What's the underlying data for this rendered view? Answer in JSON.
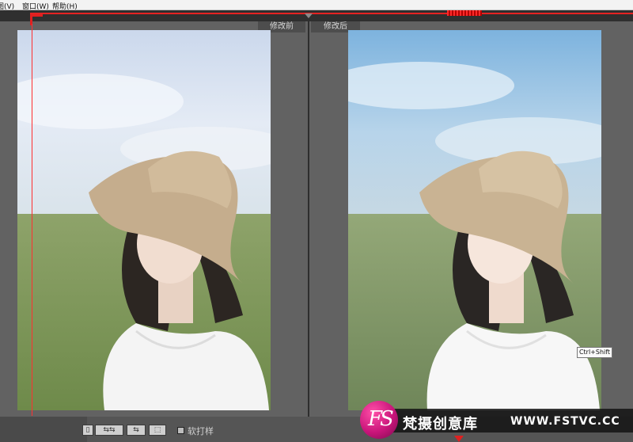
{
  "menu": {
    "items": [
      "图(V)",
      "窗口(W)",
      "帮助(H)"
    ]
  },
  "compare": {
    "before_label": "修改前",
    "after_label": "修改后"
  },
  "tooltip": {
    "text": "Ctrl+Shift"
  },
  "bottom": {
    "tool_icons": [
      "arrows-lr-icon",
      "arrows-lr-icon",
      "arrow-left-icon",
      "copy-settings-icon"
    ],
    "checkbox_label": "软打样"
  },
  "watermark": {
    "logo_text": "FS",
    "name": "梵摄创意库",
    "url": "WWW.FSTVC.CC"
  },
  "colors": {
    "accent": "#e02020",
    "panel": "#626262"
  }
}
